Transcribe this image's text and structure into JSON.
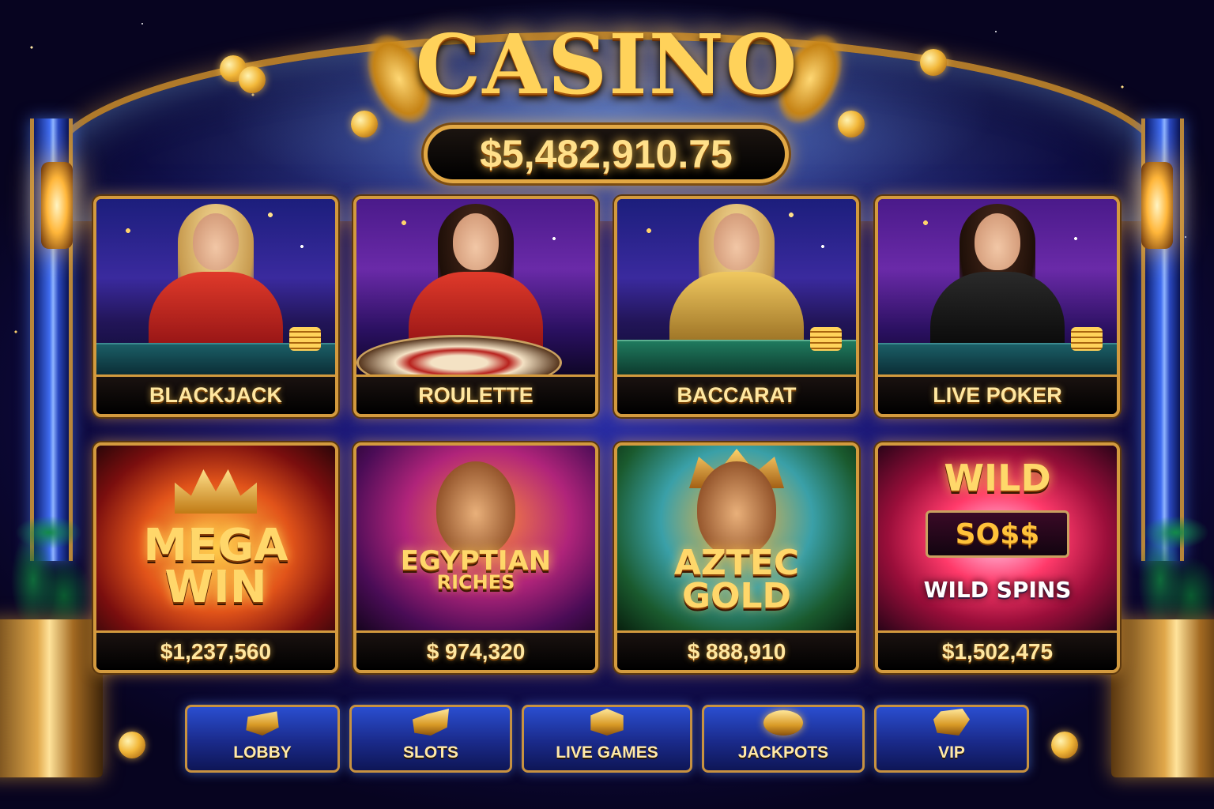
{
  "header": {
    "logo_text": "CASINO",
    "jackpot_total": "$5,482,910.75"
  },
  "live_games": [
    {
      "label": "BLACKJACK",
      "dealer": "blonde-red-dress"
    },
    {
      "label": "ROULETTE",
      "dealer": "brunette-red-dress"
    },
    {
      "label": "BACCARAT",
      "dealer": "blonde-gold-dress"
    },
    {
      "label": "LIVE POKER",
      "dealer": "brunette-black-dress"
    }
  ],
  "slot_games": [
    {
      "title_line1": "MEGA",
      "title_line2": "WIN",
      "jackpot": "$1,237,560"
    },
    {
      "title_line1": "EGYPTIAN",
      "title_line2": "RICHES",
      "jackpot": "$ 974,320"
    },
    {
      "title_line1": "AZTEC",
      "title_line2": "GOLD",
      "jackpot": "$ 888,910"
    },
    {
      "title_line1": "WILD",
      "reel_text": "SO$$",
      "title_line2": "WILD SPINS",
      "jackpot": "$1,502,475"
    }
  ],
  "nav": [
    {
      "label": "LOBBY",
      "icon": "lobby-icon"
    },
    {
      "label": "SLOTS",
      "icon": "slots-icon"
    },
    {
      "label": "LIVE GAMES",
      "icon": "live-games-icon"
    },
    {
      "label": "JACKPOTS",
      "icon": "jackpots-icon"
    },
    {
      "label": "VIP",
      "icon": "vip-icon"
    }
  ],
  "colors": {
    "gold": "#ffd25a",
    "frame_gold": "#d39a3e",
    "nav_blue": "#2a4ed0",
    "background": "#0a0626"
  }
}
